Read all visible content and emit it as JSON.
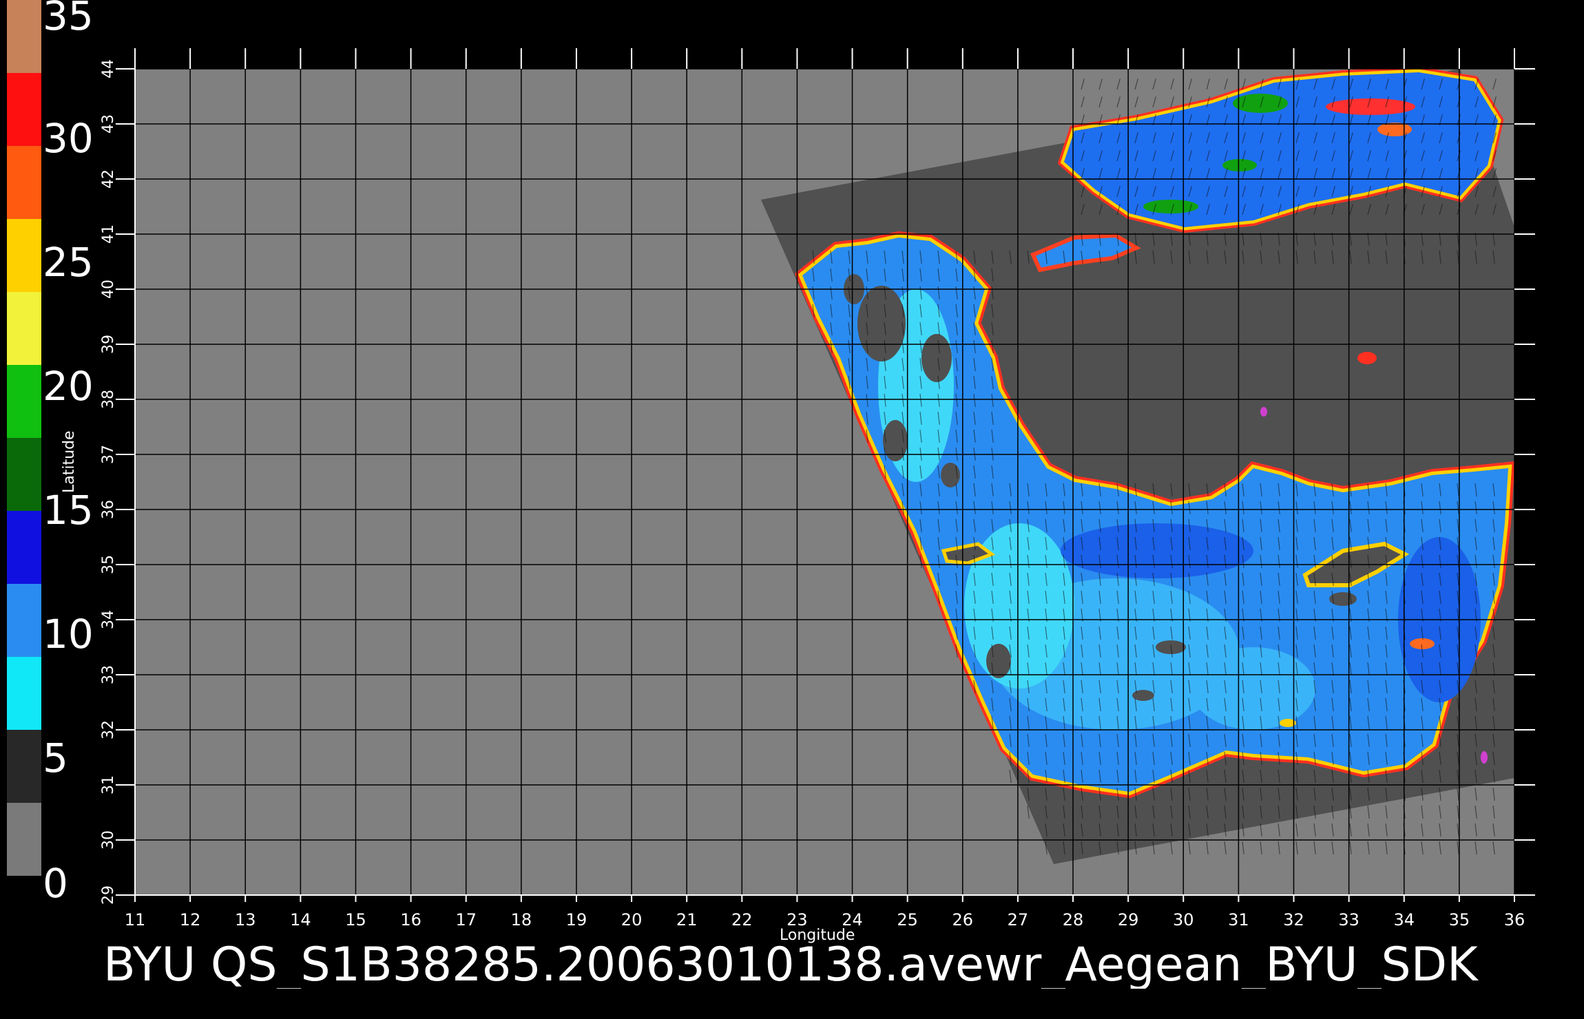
{
  "colorbar": {
    "labels": [
      "35",
      "30",
      "25",
      "20",
      "15",
      "10",
      "5",
      "0"
    ],
    "segments": [
      "#c8825a",
      "#ff1010",
      "#ff5a10",
      "#ffd000",
      "#f2f23a",
      "#10c010",
      "#0a6a0a",
      "#1010e0",
      "#2a8cf0",
      "#10e8f8",
      "#282828",
      "#7a7a7a"
    ]
  },
  "axes": {
    "xlabel": "Longitude",
    "ylabel": "Latitude",
    "xticks": [
      "11",
      "12",
      "13",
      "14",
      "15",
      "16",
      "17",
      "18",
      "19",
      "20",
      "21",
      "22",
      "23",
      "24",
      "25",
      "26",
      "27",
      "28",
      "29",
      "30",
      "31",
      "32",
      "33",
      "34",
      "35",
      "36"
    ],
    "yticks": [
      "29",
      "30",
      "31",
      "32",
      "33",
      "34",
      "35",
      "36",
      "37",
      "38",
      "39",
      "40",
      "41",
      "42",
      "43",
      "44"
    ]
  },
  "title": "BYU  QS_S1B38285.20063010138.avewr_Aegean_BYU_SDK",
  "colors": {
    "background": "#000000",
    "plot_area": "#808080",
    "swath": "#505050",
    "land": "#505050",
    "ocean": "#2a8cf0",
    "grid": "#000000",
    "coast_edge": "#ffd000"
  }
}
